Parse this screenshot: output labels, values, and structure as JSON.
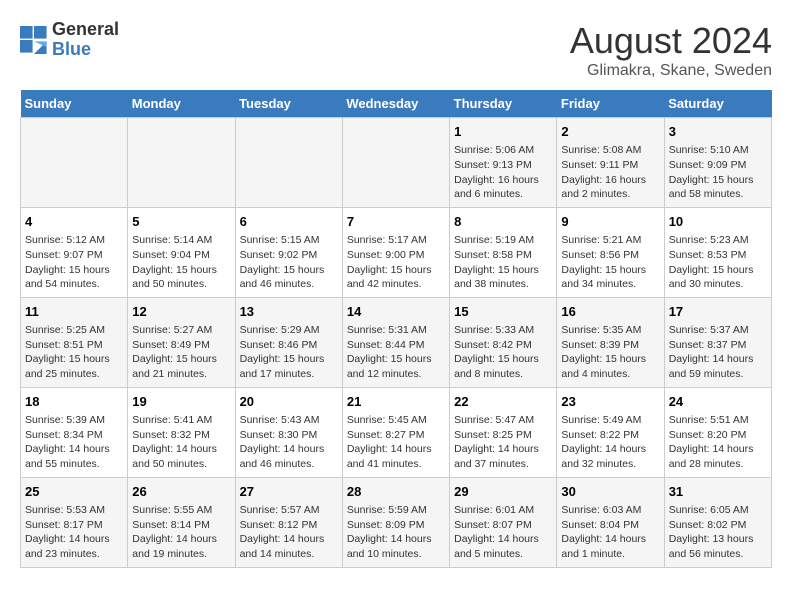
{
  "logo": {
    "line1": "General",
    "line2": "Blue"
  },
  "title": "August 2024",
  "subtitle": "Glimakra, Skane, Sweden",
  "weekdays": [
    "Sunday",
    "Monday",
    "Tuesday",
    "Wednesday",
    "Thursday",
    "Friday",
    "Saturday"
  ],
  "weeks": [
    [
      {
        "day": "",
        "info": ""
      },
      {
        "day": "",
        "info": ""
      },
      {
        "day": "",
        "info": ""
      },
      {
        "day": "",
        "info": ""
      },
      {
        "day": "1",
        "info": "Sunrise: 5:06 AM\nSunset: 9:13 PM\nDaylight: 16 hours\nand 6 minutes."
      },
      {
        "day": "2",
        "info": "Sunrise: 5:08 AM\nSunset: 9:11 PM\nDaylight: 16 hours\nand 2 minutes."
      },
      {
        "day": "3",
        "info": "Sunrise: 5:10 AM\nSunset: 9:09 PM\nDaylight: 15 hours\nand 58 minutes."
      }
    ],
    [
      {
        "day": "4",
        "info": "Sunrise: 5:12 AM\nSunset: 9:07 PM\nDaylight: 15 hours\nand 54 minutes."
      },
      {
        "day": "5",
        "info": "Sunrise: 5:14 AM\nSunset: 9:04 PM\nDaylight: 15 hours\nand 50 minutes."
      },
      {
        "day": "6",
        "info": "Sunrise: 5:15 AM\nSunset: 9:02 PM\nDaylight: 15 hours\nand 46 minutes."
      },
      {
        "day": "7",
        "info": "Sunrise: 5:17 AM\nSunset: 9:00 PM\nDaylight: 15 hours\nand 42 minutes."
      },
      {
        "day": "8",
        "info": "Sunrise: 5:19 AM\nSunset: 8:58 PM\nDaylight: 15 hours\nand 38 minutes."
      },
      {
        "day": "9",
        "info": "Sunrise: 5:21 AM\nSunset: 8:56 PM\nDaylight: 15 hours\nand 34 minutes."
      },
      {
        "day": "10",
        "info": "Sunrise: 5:23 AM\nSunset: 8:53 PM\nDaylight: 15 hours\nand 30 minutes."
      }
    ],
    [
      {
        "day": "11",
        "info": "Sunrise: 5:25 AM\nSunset: 8:51 PM\nDaylight: 15 hours\nand 25 minutes."
      },
      {
        "day": "12",
        "info": "Sunrise: 5:27 AM\nSunset: 8:49 PM\nDaylight: 15 hours\nand 21 minutes."
      },
      {
        "day": "13",
        "info": "Sunrise: 5:29 AM\nSunset: 8:46 PM\nDaylight: 15 hours\nand 17 minutes."
      },
      {
        "day": "14",
        "info": "Sunrise: 5:31 AM\nSunset: 8:44 PM\nDaylight: 15 hours\nand 12 minutes."
      },
      {
        "day": "15",
        "info": "Sunrise: 5:33 AM\nSunset: 8:42 PM\nDaylight: 15 hours\nand 8 minutes."
      },
      {
        "day": "16",
        "info": "Sunrise: 5:35 AM\nSunset: 8:39 PM\nDaylight: 15 hours\nand 4 minutes."
      },
      {
        "day": "17",
        "info": "Sunrise: 5:37 AM\nSunset: 8:37 PM\nDaylight: 14 hours\nand 59 minutes."
      }
    ],
    [
      {
        "day": "18",
        "info": "Sunrise: 5:39 AM\nSunset: 8:34 PM\nDaylight: 14 hours\nand 55 minutes."
      },
      {
        "day": "19",
        "info": "Sunrise: 5:41 AM\nSunset: 8:32 PM\nDaylight: 14 hours\nand 50 minutes."
      },
      {
        "day": "20",
        "info": "Sunrise: 5:43 AM\nSunset: 8:30 PM\nDaylight: 14 hours\nand 46 minutes."
      },
      {
        "day": "21",
        "info": "Sunrise: 5:45 AM\nSunset: 8:27 PM\nDaylight: 14 hours\nand 41 minutes."
      },
      {
        "day": "22",
        "info": "Sunrise: 5:47 AM\nSunset: 8:25 PM\nDaylight: 14 hours\nand 37 minutes."
      },
      {
        "day": "23",
        "info": "Sunrise: 5:49 AM\nSunset: 8:22 PM\nDaylight: 14 hours\nand 32 minutes."
      },
      {
        "day": "24",
        "info": "Sunrise: 5:51 AM\nSunset: 8:20 PM\nDaylight: 14 hours\nand 28 minutes."
      }
    ],
    [
      {
        "day": "25",
        "info": "Sunrise: 5:53 AM\nSunset: 8:17 PM\nDaylight: 14 hours\nand 23 minutes."
      },
      {
        "day": "26",
        "info": "Sunrise: 5:55 AM\nSunset: 8:14 PM\nDaylight: 14 hours\nand 19 minutes."
      },
      {
        "day": "27",
        "info": "Sunrise: 5:57 AM\nSunset: 8:12 PM\nDaylight: 14 hours\nand 14 minutes."
      },
      {
        "day": "28",
        "info": "Sunrise: 5:59 AM\nSunset: 8:09 PM\nDaylight: 14 hours\nand 10 minutes."
      },
      {
        "day": "29",
        "info": "Sunrise: 6:01 AM\nSunset: 8:07 PM\nDaylight: 14 hours\nand 5 minutes."
      },
      {
        "day": "30",
        "info": "Sunrise: 6:03 AM\nSunset: 8:04 PM\nDaylight: 14 hours\nand 1 minute."
      },
      {
        "day": "31",
        "info": "Sunrise: 6:05 AM\nSunset: 8:02 PM\nDaylight: 13 hours\nand 56 minutes."
      }
    ]
  ]
}
